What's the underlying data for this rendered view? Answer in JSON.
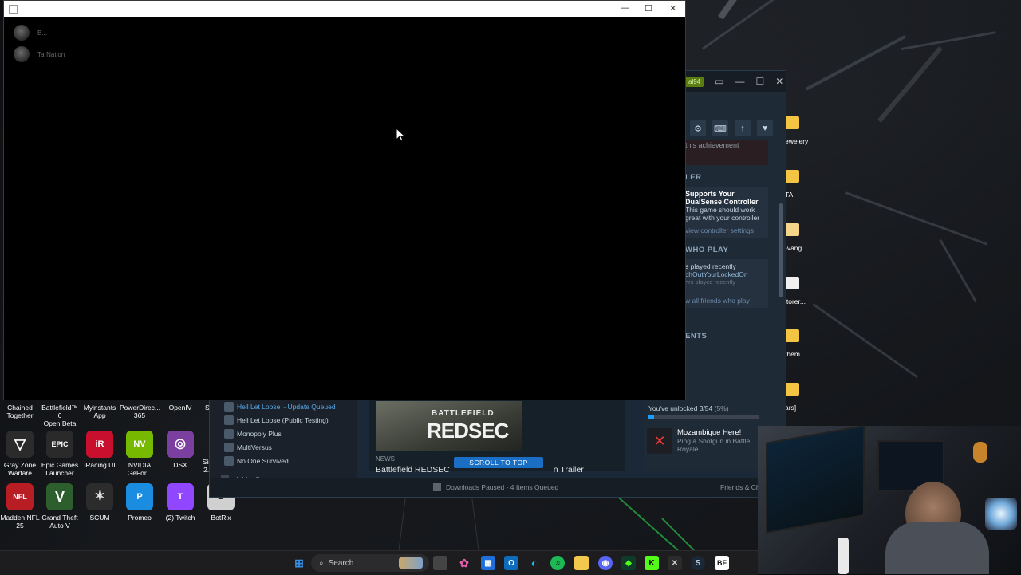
{
  "steam": {
    "user_badge": "al94",
    "panel": {
      "achievement_hint": "this achievement",
      "controller_heading": "LER",
      "controller_title_1": "Supports Your",
      "controller_title_2": "DualSense Controller",
      "controller_body_1": "This game should work",
      "controller_body_2": "great with your controller",
      "controller_link": "view controller settings",
      "friends_heading": "WHO PLAY",
      "friends_line_1": "s played recently",
      "friends_name": "chOutYourLockedOn",
      "friends_hrs": "hrs played recently",
      "friends_link": "w all friends who play",
      "achievements_heading": "ENTS"
    },
    "library": {
      "items": [
        {
          "name": "Hell Let Loose",
          "suffix": " - Update Queued"
        },
        {
          "name": "Hell Let Loose (Public Testing)",
          "suffix": ""
        },
        {
          "name": "Monopoly Plus",
          "suffix": ""
        },
        {
          "name": "MultiVersus",
          "suffix": ""
        },
        {
          "name": "No One Survived",
          "suffix": ""
        }
      ],
      "add_game": "Add a Game"
    },
    "news": {
      "logo_top": "BATTLEFIELD",
      "logo_main": "REDSEC",
      "tag": "NEWS",
      "title": "Battlefield REDSEC",
      "title_tail": "n Trailer",
      "scroll_to_top": "SCROLL TO TOP"
    },
    "achievements": {
      "unlocked_text": "You've unlocked 3/54",
      "unlocked_pct": "(5%)",
      "progress": 0.05,
      "latest_name": "Mozambique Here!",
      "latest_desc_1": "Ping a Shotgun in Battle",
      "latest_desc_2": "Royale"
    },
    "bottom": {
      "downloads": "Downloads Paused - 4 Items Queued",
      "friends": "Friends & Ch"
    }
  },
  "black_window": {
    "rows": [
      {
        "name": "B..."
      },
      {
        "name": "TarNation"
      }
    ]
  },
  "desktop": {
    "icons_row1": [
      {
        "label": "Chained\nTogether",
        "color": "#3a3a3a"
      },
      {
        "label": "Battlefield™ 6\nOpen Beta",
        "color": "#b8262a"
      },
      {
        "label": "Myinstants\nApp",
        "color": "#e0e0e0"
      },
      {
        "label": "PowerDirec...\n365",
        "color": "#1d6fd1"
      },
      {
        "label": "OpenIV",
        "color": "#222"
      },
      {
        "label": "St",
        "color": "#333"
      }
    ],
    "icons_row2": [
      {
        "label": "Gray Zone\nWarfare",
        "glyph": "▽",
        "color": "#2b2b2b"
      },
      {
        "label": "Epic Games\nLauncher",
        "glyph": "EPIC",
        "color": "#2a2a2a"
      },
      {
        "label": "iRacing UI",
        "glyph": "iR",
        "color": "#c8102e"
      },
      {
        "label": "NVIDIA\nGeFor...",
        "glyph": "NV",
        "color": "#76b900"
      },
      {
        "label": "DSX",
        "glyph": "◎",
        "color": "#7b3fa0"
      },
      {
        "label": "Sim\n2.0",
        "glyph": "",
        "color": "#333"
      }
    ],
    "icons_row3": [
      {
        "label": "Madden NFL\n25",
        "glyph": "NFL",
        "color": "#b81d24"
      },
      {
        "label": "Grand Theft\nAuto V",
        "glyph": "V",
        "color": "#2d5e2d"
      },
      {
        "label": "SCUM",
        "glyph": "✶",
        "color": "#2c2c2c"
      },
      {
        "label": "Promeo",
        "glyph": "P",
        "color": "#1a8de0"
      },
      {
        "label": "(2) Twitch",
        "glyph": "T",
        "color": "#9146ff"
      },
      {
        "label": "BotRix",
        "glyph": "B",
        "color": "#d0d0d0"
      }
    ],
    "right_folders": [
      {
        "label": "ewelery"
      },
      {
        "label": "TA"
      },
      {
        "label": "-vang..."
      },
      {
        "label": "itorer..."
      },
      {
        "label": "them..."
      },
      {
        "label": "ars]"
      }
    ]
  },
  "taskbar": {
    "search_placeholder": "Search"
  }
}
